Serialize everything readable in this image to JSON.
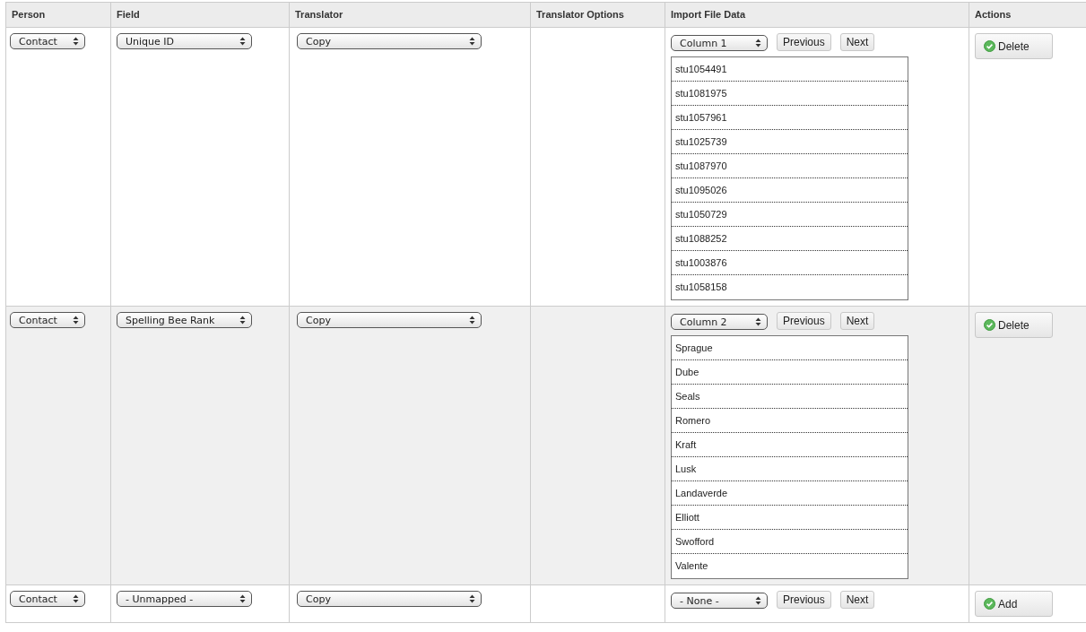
{
  "table": {
    "columns": [
      "Person",
      "Field",
      "Translator",
      "Translator Options",
      "Import File Data",
      "Actions"
    ],
    "rows": [
      {
        "shaded": false,
        "person": "Contact",
        "field": "Unique ID",
        "translator": "Copy",
        "column": "Column 1",
        "previous": "Previous",
        "next": "Next",
        "values": [
          "stu1054491",
          "stu1081975",
          "stu1057961",
          "stu1025739",
          "stu1087970",
          "stu1095026",
          "stu1050729",
          "stu1088252",
          "stu1003876",
          "stu1058158"
        ],
        "action": "Delete"
      },
      {
        "shaded": true,
        "person": "Contact",
        "field": "Spelling Bee Rank",
        "translator": "Copy",
        "column": "Column 2",
        "previous": "Previous",
        "next": "Next",
        "values": [
          "Sprague",
          "Dube",
          "Seals",
          "Romero",
          "Kraft",
          "Lusk",
          "Landaverde",
          "Elliott",
          "Swofford",
          "Valente"
        ],
        "action": "Delete"
      },
      {
        "shaded": false,
        "person": "Contact",
        "field": "- Unmapped -",
        "translator": "Copy",
        "column": "- None -",
        "previous": "Previous",
        "next": "Next",
        "action": "Add"
      }
    ]
  }
}
